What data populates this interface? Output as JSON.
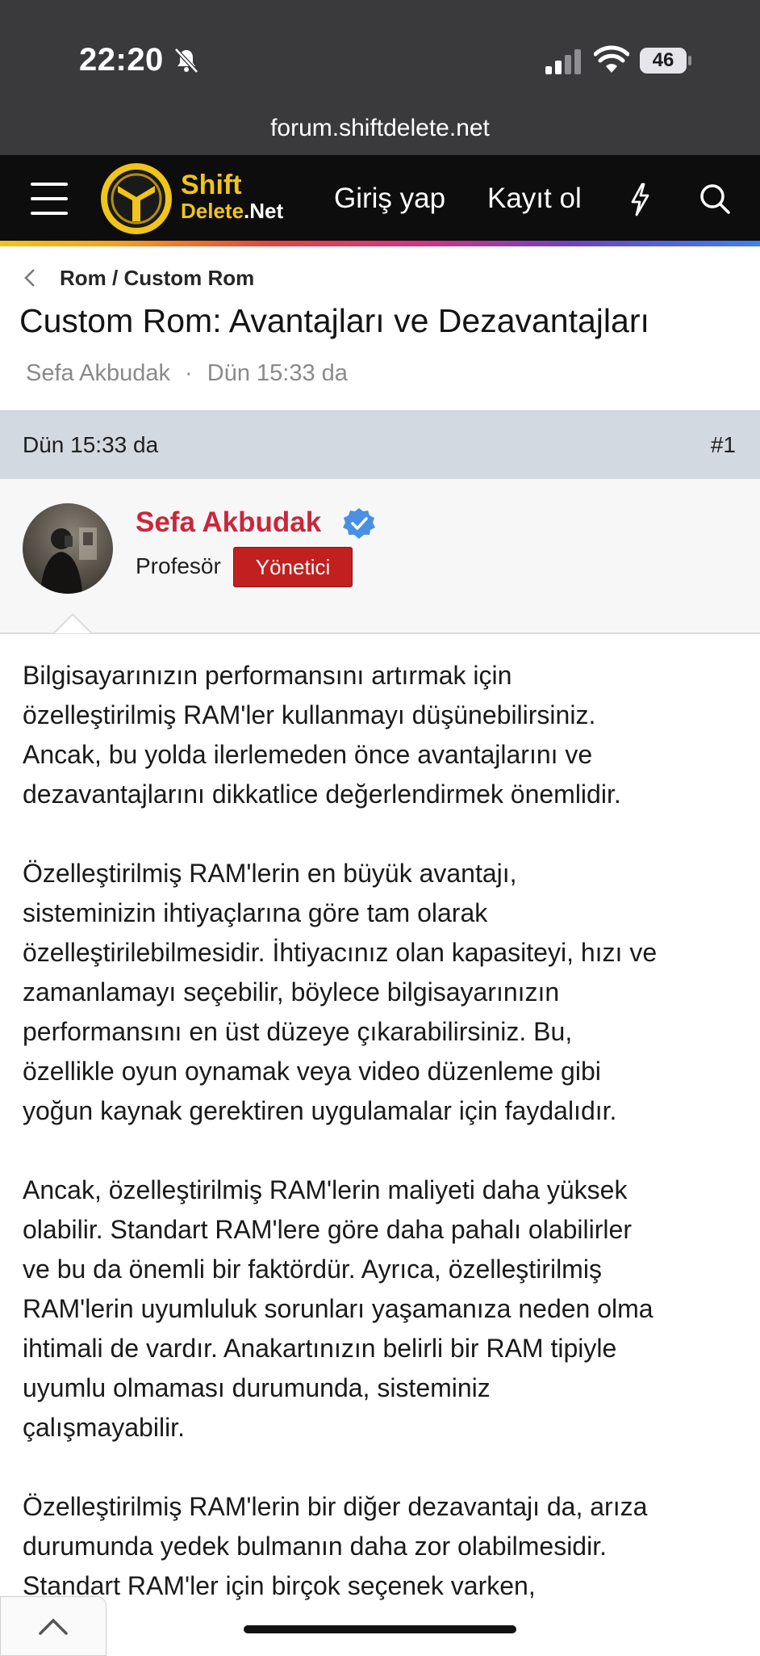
{
  "status_bar": {
    "time": "22:20",
    "battery": "46",
    "icons": [
      "bell-slash-icon",
      "cell-signal-icon",
      "wifi-icon",
      "battery-icon"
    ]
  },
  "browser": {
    "url": "forum.shiftdelete.net"
  },
  "header": {
    "logo_line1": "Shift",
    "logo_line2_a": "Delete",
    "logo_line2_b": ".Net",
    "login": "Giriş yap",
    "register": "Kayıt ol",
    "accent_color": "#f0c419"
  },
  "breadcrumb": {
    "label": "Rom / Custom Rom"
  },
  "thread": {
    "title": "Custom Rom: Avantajları ve Dezavantajları",
    "author": "Sefa Akbudak",
    "separator": "·",
    "date": "Dün 15:33 da"
  },
  "post": {
    "date": "Dün 15:33 da",
    "number": "#1",
    "author_name": "Sefa Akbudak",
    "author_title": "Profesör",
    "author_badge": "Yönetici",
    "author_color": "#c8283a",
    "badge_color": "#c0201f",
    "paragraphs": [
      "Bilgisayarınızın performansını artırmak için\nözelleştirilmiş RAM'ler kullanmayı düşünebilirsiniz.\nAncak, bu yolda ilerlemeden önce avantajlarını ve\ndezavantajlarını dikkatlice değerlendirmek önemlidir.",
      "Özelleştirilmiş RAM'lerin en büyük avantajı,\nsisteminizin ihtiyaçlarına göre tam olarak\nözelleştirilebilmesidir. İhtiyacınız olan kapasiteyi, hızı ve\nzamanlamayı seçebilir, böylece bilgisayarınızın\nperformansını en üst düzeye çıkarabilirsiniz. Bu,\nözellikle oyun oynamak veya video düzenleme gibi\nyoğun kaynak gerektiren uygulamalar için faydalıdır.",
      "Ancak, özelleştirilmiş RAM'lerin maliyeti daha yüksek\nolabilir. Standart RAM'lere göre daha pahalı olabilirler\nve bu da önemli bir faktördür. Ayrıca, özelleştirilmiş\nRAM'lerin uyumluluk sorunları yaşamanıza neden olma\nihtimali de vardır. Anakartınızın belirli bir RAM tipiyle\nuyumlu olmaması durumunda, sisteminiz\nçalışmayabilir.",
      "Özelleştirilmiş RAM'lerin bir diğer dezavantajı da, arıza\ndurumunda yedek bulmanın daha zor olabilmesidir.\nStandart RAM'ler için birçok seçenek varken,"
    ]
  }
}
